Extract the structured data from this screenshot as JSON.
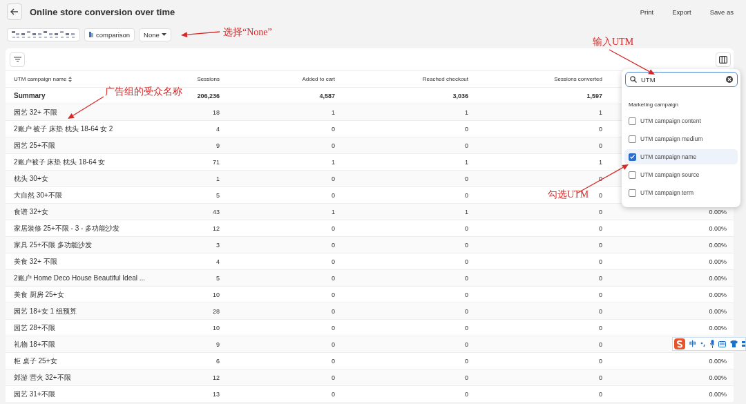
{
  "header": {
    "title": "Online store conversion over time",
    "actions": [
      "Print",
      "Export",
      "Save as"
    ]
  },
  "filters": {
    "comparison_chip": "comparison",
    "dropdown_chip": "None"
  },
  "table": {
    "columns": [
      "UTM campaign name",
      "Sessions",
      "Added to cart",
      "Reached checkout",
      "Sessions converted"
    ],
    "summary": [
      "Summary",
      "206,236",
      "4,587",
      "3,036",
      "1,597"
    ],
    "rows": [
      {
        "cells": [
          "园艺 32+ 不限",
          "18",
          "1",
          "1",
          "1"
        ]
      },
      {
        "cells": [
          "2账户 被子 床垫 枕头 18-64 女 2",
          "4",
          "0",
          "0",
          "0"
        ]
      },
      {
        "cells": [
          "园艺 25+不限",
          "9",
          "0",
          "0",
          "0"
        ]
      },
      {
        "cells": [
          "2账户被子 床垫 枕头 18-64 女",
          "71",
          "1",
          "1",
          "1"
        ]
      },
      {
        "cells": [
          "枕头 30+女",
          "1",
          "0",
          "0",
          "0"
        ]
      },
      {
        "cells": [
          "大自然 30+不限",
          "5",
          "0",
          "0",
          "0"
        ]
      },
      {
        "cells": [
          "食谱 32+女",
          "43",
          "1",
          "1",
          "0",
          "0.00%"
        ]
      },
      {
        "cells": [
          "家居装修 25+不限 - 3 - 多功能沙发",
          "12",
          "0",
          "0",
          "0",
          "0.00%"
        ]
      },
      {
        "cells": [
          "家具 25+不限 多功能沙发",
          "3",
          "0",
          "0",
          "0",
          "0.00%"
        ]
      },
      {
        "cells": [
          "美食 32+ 不限",
          "4",
          "0",
          "0",
          "0",
          "0.00%"
        ]
      },
      {
        "cells": [
          "2账户 Home Deco House Beautiful Ideal ...",
          "5",
          "0",
          "0",
          "0",
          "0.00%"
        ]
      },
      {
        "cells": [
          "美食 厨房 25+女",
          "10",
          "0",
          "0",
          "0",
          "0.00%"
        ]
      },
      {
        "cells": [
          "园艺 18+女 1 组预算",
          "28",
          "0",
          "0",
          "0",
          "0.00%"
        ]
      },
      {
        "cells": [
          "园艺 28+不限",
          "10",
          "0",
          "0",
          "0",
          "0.00%"
        ]
      },
      {
        "cells": [
          "礼物 18+不限",
          "9",
          "0",
          "0",
          "0"
        ]
      },
      {
        "cells": [
          "柜 桌子 25+女",
          "6",
          "0",
          "0",
          "0",
          "0.00%"
        ]
      },
      {
        "cells": [
          "郊游 营火 32+不限",
          "12",
          "0",
          "0",
          "0",
          "0.00%"
        ]
      },
      {
        "cells": [
          "园艺 31+不限",
          "13",
          "0",
          "0",
          "0",
          "0.00%"
        ]
      }
    ]
  },
  "column_picker": {
    "search": {
      "value": "UTM"
    },
    "group": "Marketing campaign",
    "options": [
      {
        "label": "UTM campaign content",
        "checked": false
      },
      {
        "label": "UTM campaign medium",
        "checked": false
      },
      {
        "label": "UTM campaign name",
        "checked": true
      },
      {
        "label": "UTM campaign source",
        "checked": false
      },
      {
        "label": "UTM campaign term",
        "checked": false
      }
    ]
  },
  "annotations": [
    {
      "text": "选择“None”"
    },
    {
      "text": "输入UTM"
    },
    {
      "text": "广告组的受众名称"
    },
    {
      "text": "勾选UTM"
    }
  ],
  "ime_toolbar": {
    "mode": "中"
  }
}
